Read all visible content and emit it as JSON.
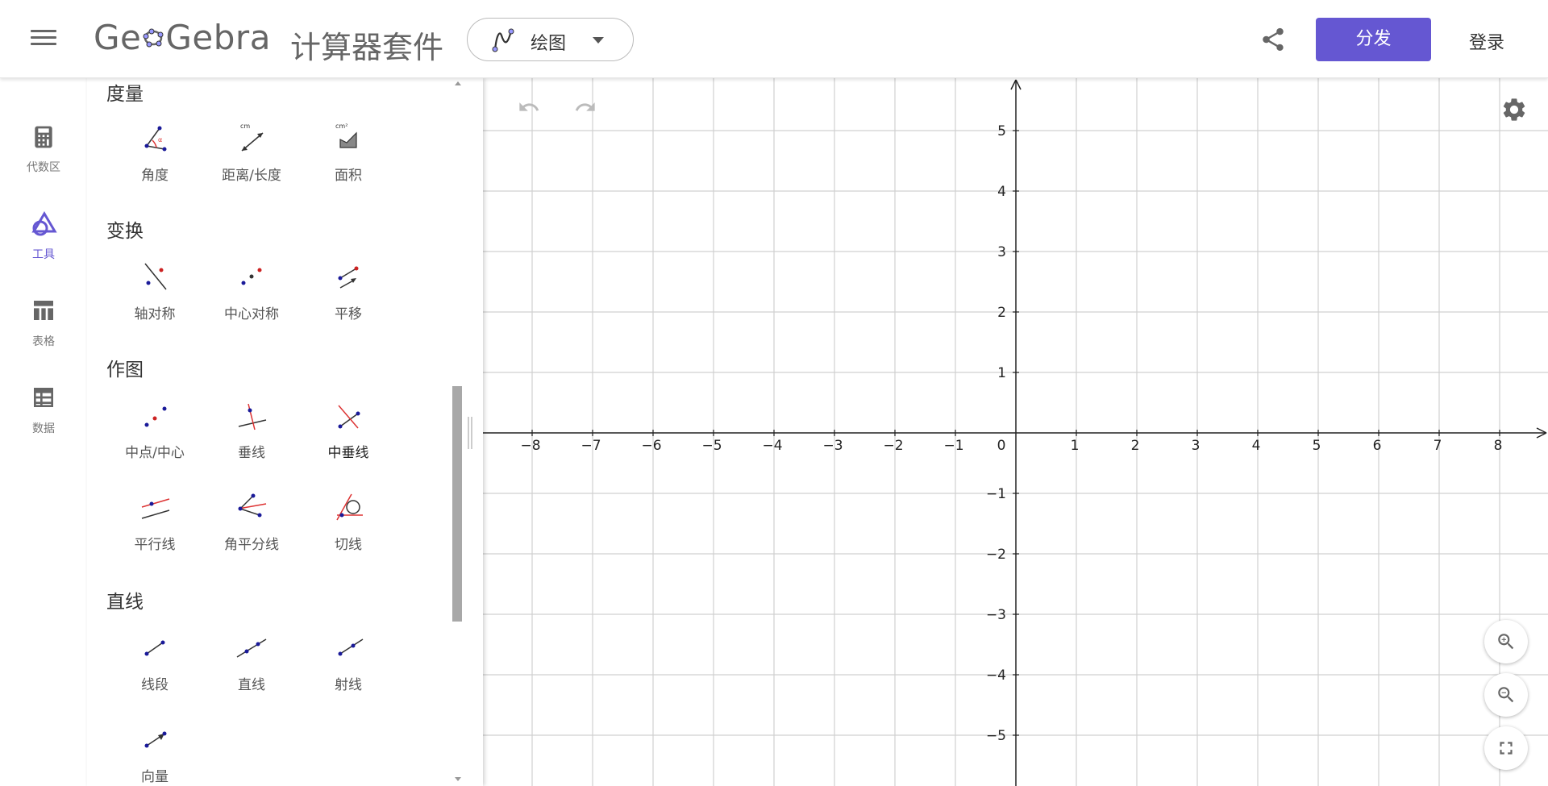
{
  "header": {
    "logo_text_prefix": "Ge",
    "logo_text_suffix": "Gebra",
    "suite_title": "计算器套件",
    "app_selector_label": "绘图",
    "publish_label": "分发",
    "login_label": "登录"
  },
  "rail": {
    "items": [
      {
        "label": "代数区",
        "icon": "calculator-icon"
      },
      {
        "label": "工具",
        "icon": "tools-icon",
        "active": true
      },
      {
        "label": "表格",
        "icon": "table-icon"
      },
      {
        "label": "数据",
        "icon": "data-icon"
      }
    ]
  },
  "tools": {
    "sections": [
      {
        "title": "度量",
        "tools": [
          {
            "label": "角度"
          },
          {
            "label": "距离/长度"
          },
          {
            "label": "面积"
          }
        ]
      },
      {
        "title": "变换",
        "tools": [
          {
            "label": "轴对称"
          },
          {
            "label": "中心对称"
          },
          {
            "label": "平移"
          }
        ]
      },
      {
        "title": "作图",
        "tools": [
          {
            "label": "中点/中心"
          },
          {
            "label": "垂线"
          },
          {
            "label": "中垂线"
          },
          {
            "label": "平行线"
          },
          {
            "label": "角平分线"
          },
          {
            "label": "切线"
          }
        ]
      },
      {
        "title": "直线",
        "tools": [
          {
            "label": "线段"
          },
          {
            "label": "直线"
          },
          {
            "label": "射线"
          },
          {
            "label": "向量"
          }
        ]
      }
    ]
  },
  "graphics": {
    "x_ticks": [
      "−8",
      "−7",
      "−6",
      "−5",
      "−4",
      "−3",
      "−2",
      "−1",
      "0",
      "1",
      "2",
      "3",
      "4",
      "5",
      "6",
      "7",
      "8"
    ],
    "y_ticks": [
      "5",
      "4",
      "3",
      "2",
      "1",
      "−1",
      "−2",
      "−3",
      "−4",
      "−5"
    ],
    "accent_color": "#6557d2"
  }
}
